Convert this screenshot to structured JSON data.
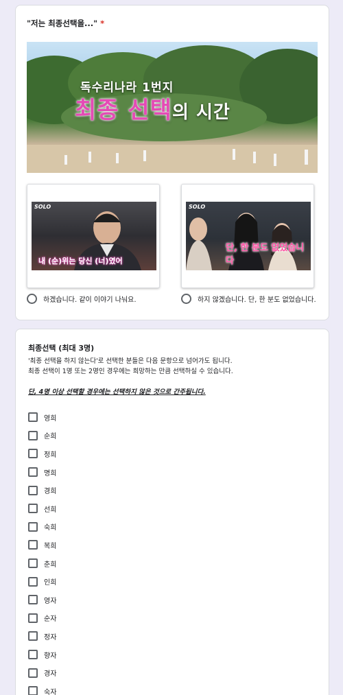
{
  "question1": {
    "title": "\"저는 최종선택을...\"",
    "required_mark": "*",
    "banner": {
      "small_title": "독수리나라 1번지",
      "big_title": "최종 선택",
      "big_suffix": "의 시간"
    },
    "options": [
      {
        "label": "하겠습니다. 같이 이야기 나눠요.",
        "thumb_logo": "SOLO",
        "thumb_caption": "내 (순)위는 당신 (너)였어"
      },
      {
        "label": "하지 않겠습니다. 단, 한 분도 없었습니다.",
        "thumb_logo": "SOLO",
        "thumb_caption": "단, 한 분도 없었습니다"
      }
    ]
  },
  "question2": {
    "title": "최종선택 (최대 3명)",
    "desc_line1": "'최종 선택을 하지 않는다'로 선택한 분들은 다음 문항으로 넘어가도 됩니다.",
    "desc_line2": "최종 선택이 1명 또는 2명인 경우에는 희망하는 만큼 선택하실 수 있습니다.",
    "warning": "단, 4명 이상 선택할 경우에는 선택하지 않은 것으로 간주됩니다.",
    "choices": [
      "영희",
      "순희",
      "정희",
      "명희",
      "경희",
      "선희",
      "숙희",
      "복희",
      "춘희",
      "인희",
      "영자",
      "순자",
      "정자",
      "향자",
      "경자",
      "숙자"
    ]
  },
  "colors": {
    "background": "#edebf7",
    "required": "#d93025",
    "title_pink": "#e44bb5"
  }
}
